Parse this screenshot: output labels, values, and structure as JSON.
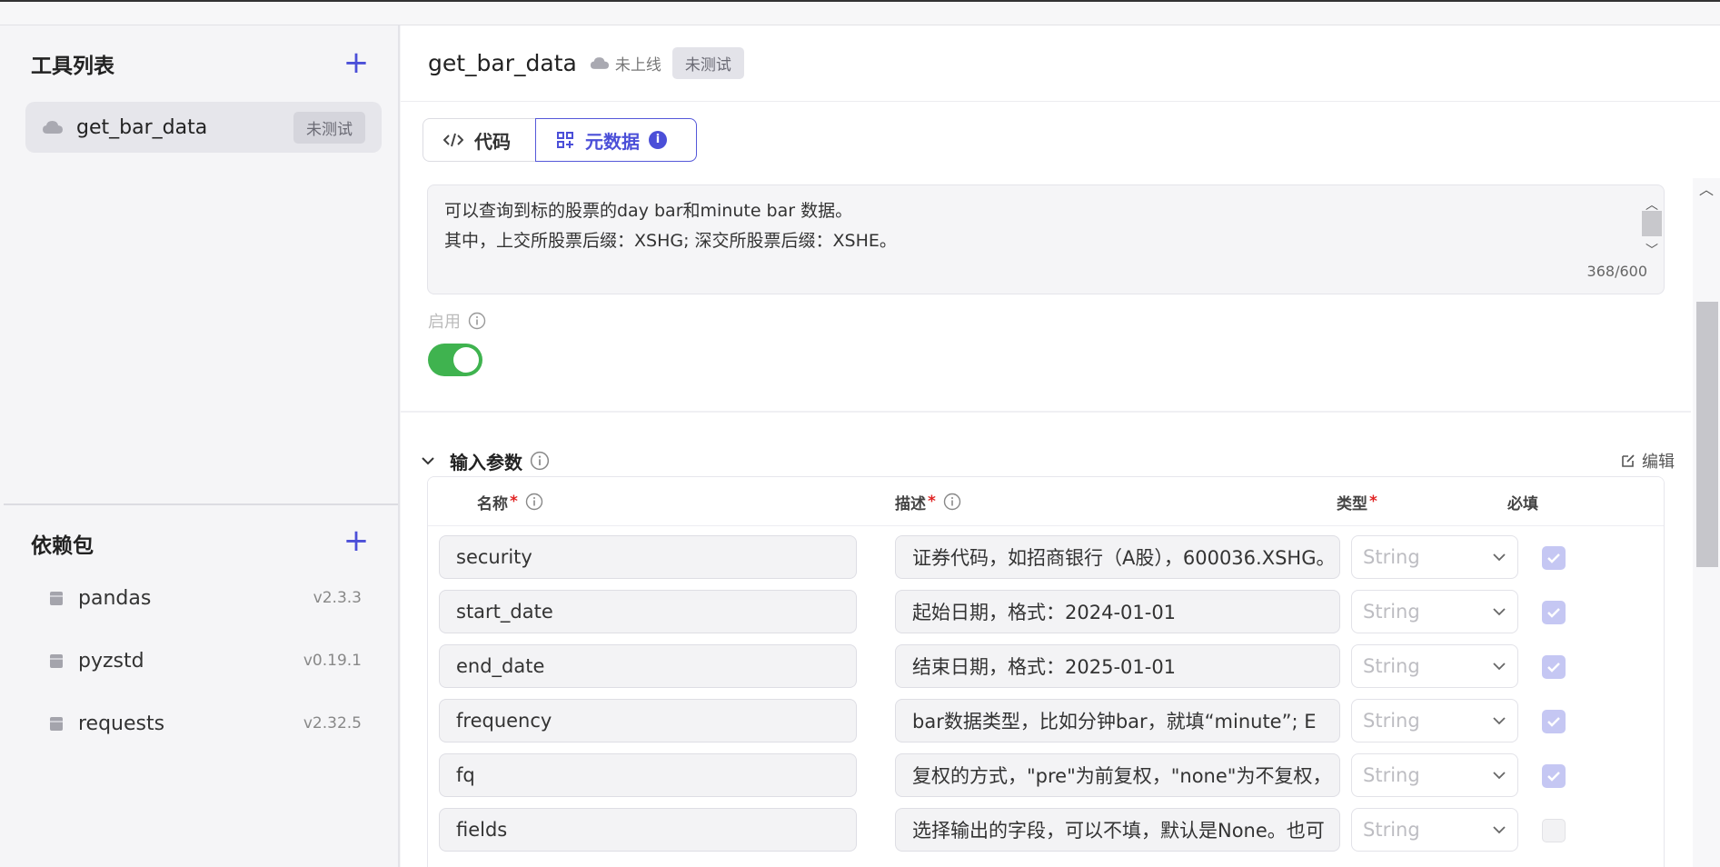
{
  "sidebar": {
    "tools_title": "工具列表",
    "tools": [
      {
        "name": "get_bar_data",
        "status": "未测试"
      }
    ],
    "deps_title": "依赖包",
    "deps": [
      {
        "name": "pandas",
        "version": "v2.3.3"
      },
      {
        "name": "pyzstd",
        "version": "v0.19.1"
      },
      {
        "name": "requests",
        "version": "v2.32.5"
      }
    ]
  },
  "main": {
    "title": "get_bar_data",
    "status": "未上线",
    "test_badge": "未测试",
    "tabs": [
      {
        "label": "代码"
      },
      {
        "label": "元数据"
      }
    ],
    "description": {
      "line1": "可以查询到标的股票的day bar和minute bar 数据。",
      "line2": "其中，上交所股票后缀：XSHG; 深交所股票后缀：XSHE。",
      "count": "368/600"
    },
    "enable_label": "启用",
    "enabled": true,
    "params_section": {
      "title": "输入参数",
      "edit_label": "编辑",
      "headers": {
        "name": "名称",
        "desc": "描述",
        "type": "类型",
        "required": "必填"
      },
      "rows": [
        {
          "name": "security",
          "desc": "证券代码，如招商银行（A股），600036.XSHG。",
          "type": "String",
          "required": true
        },
        {
          "name": "start_date",
          "desc": "起始日期，格式：2024-01-01",
          "type": "String",
          "required": true
        },
        {
          "name": "end_date",
          "desc": "结束日期，格式：2025-01-01",
          "type": "String",
          "required": true
        },
        {
          "name": "frequency",
          "desc": "bar数据类型，比如分钟bar，就填“minute”; E",
          "type": "String",
          "required": true
        },
        {
          "name": "fq",
          "desc": "复权的方式，\"pre\"为前复权，\"none\"为不复权，",
          "type": "String",
          "required": true
        },
        {
          "name": "fields",
          "desc": "选择输出的字段，可以不填，默认是None。也可",
          "type": "String",
          "required": false
        }
      ]
    }
  },
  "colors": {
    "accent": "#4b4fd8",
    "toggle_on": "#3fb34f",
    "required_star": "#e02424"
  }
}
